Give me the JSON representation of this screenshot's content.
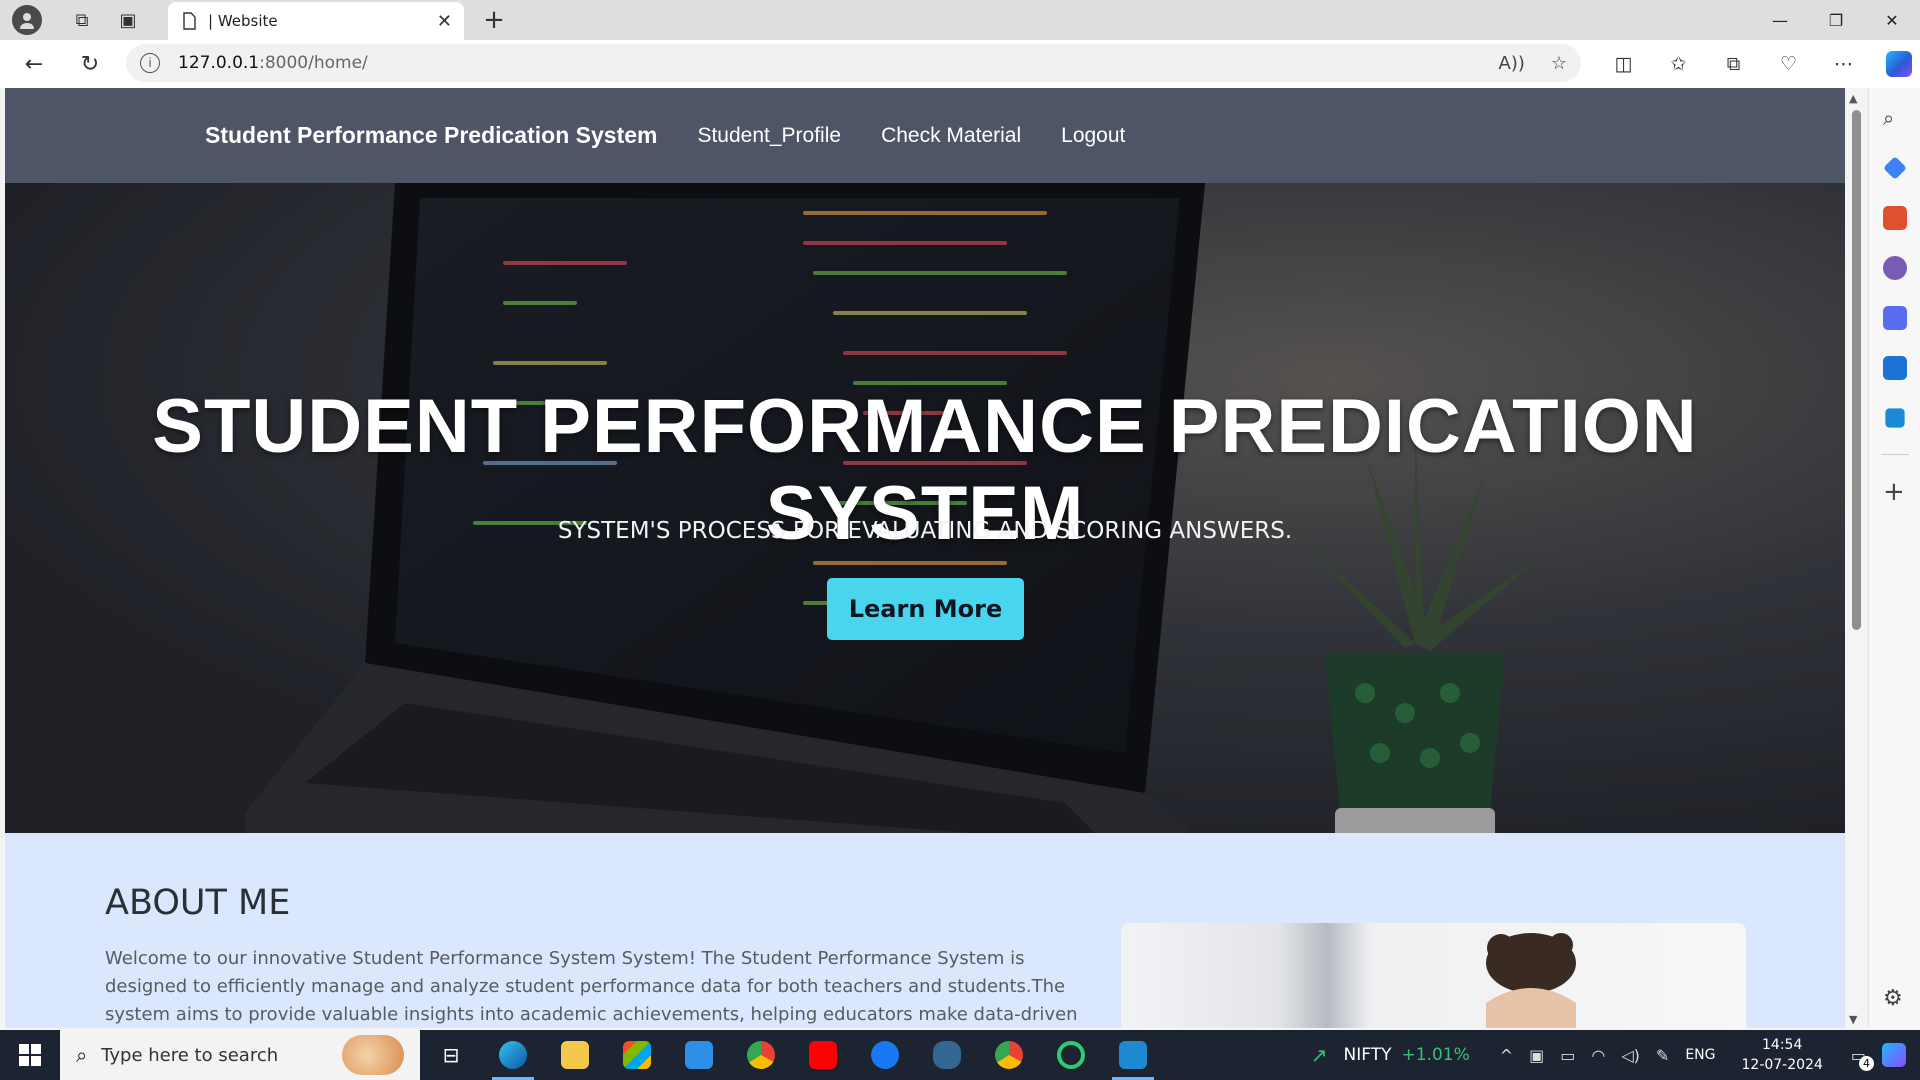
{
  "browser": {
    "tab_title": "| Website",
    "url_host": "127.0.0.1",
    "url_path": ":8000/home/"
  },
  "site": {
    "brand": "Student Performance Predication System",
    "nav": [
      "Student_Profile",
      "Check Material",
      "Logout"
    ]
  },
  "hero": {
    "title": "STUDENT PERFORMANCE PREDICATION SYSTEM",
    "subtitle": "SYSTEM'S PROCESS FOR EVALUATING AND SCORING ANSWERS.",
    "button": "Learn More"
  },
  "about": {
    "heading": "ABOUT ME",
    "text": "Welcome to our innovative Student Performance System System! The Student Performance System is designed to efficiently manage and analyze student performance data for both teachers and students.The system aims to provide valuable insights into academic achievements, helping educators make data-driven decisions and aiding students in"
  },
  "taskbar": {
    "search_placeholder": "Type here to search",
    "nifty_label": "NIFTY",
    "nifty_change": "+1.01%",
    "language": "ENG",
    "time": "14:54",
    "date": "12-07-2024",
    "notifications": "4"
  },
  "colors": {
    "nav_bg": "#4d5566",
    "button_bg": "#4ad5ef",
    "about_bg": "#dbe7fd",
    "taskbar_bg": "#1c2431"
  }
}
